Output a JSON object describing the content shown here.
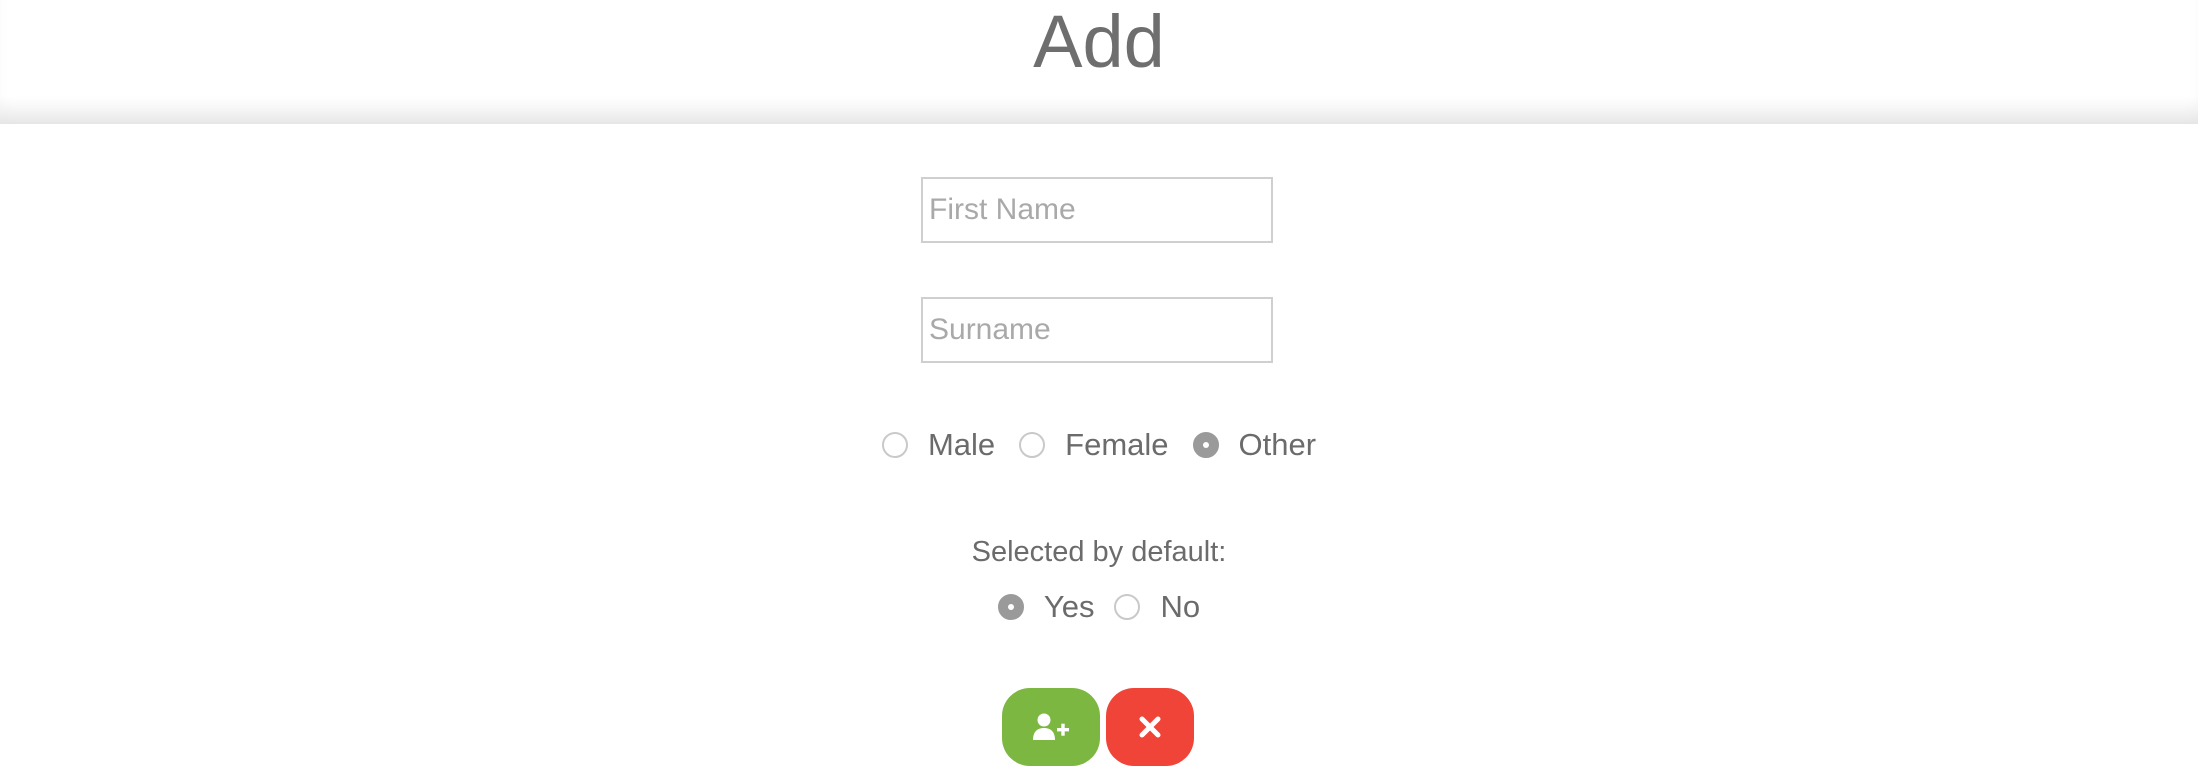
{
  "header": {
    "title": "Add"
  },
  "form": {
    "first_name": {
      "value": "",
      "placeholder": "First Name"
    },
    "surname": {
      "value": "",
      "placeholder": "Surname"
    },
    "gender": {
      "options": [
        {
          "label": "Male",
          "selected": false
        },
        {
          "label": "Female",
          "selected": false
        },
        {
          "label": "Other",
          "selected": true
        }
      ]
    },
    "selected_by_default": {
      "label": "Selected by default:",
      "options": [
        {
          "label": "Yes",
          "selected": true
        },
        {
          "label": "No",
          "selected": false
        }
      ]
    }
  },
  "actions": {
    "add": {
      "icon": "add-user-icon",
      "color": "#7cb742"
    },
    "cancel": {
      "icon": "close-icon",
      "color": "#f04438"
    }
  },
  "colors": {
    "text": "#6b6b6b",
    "radio_checked": "#9a9a9a",
    "input_border": "#cfcfcf"
  }
}
